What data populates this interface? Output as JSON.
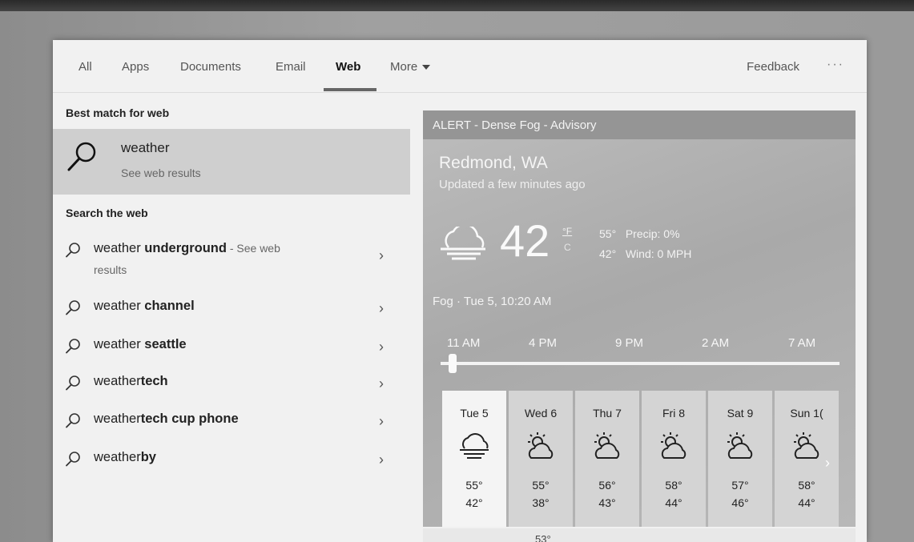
{
  "tabs": [
    {
      "label": "All"
    },
    {
      "label": "Apps"
    },
    {
      "label": "Documents"
    },
    {
      "label": "Email"
    },
    {
      "label": "Web"
    },
    {
      "label": "More"
    }
  ],
  "feedback_label": "Feedback",
  "more_menu_label": "···",
  "left": {
    "best_match_heading": "Best match for web",
    "best_match": {
      "title": "weather",
      "subtitle": "See web results"
    },
    "search_web_heading": "Search the web",
    "suggestions": [
      {
        "prefix": "weather ",
        "bold": "underground",
        "suffix": " - See web",
        "line2": "results"
      },
      {
        "prefix": "weather ",
        "bold": "channel"
      },
      {
        "prefix": "weather ",
        "bold": "seattle"
      },
      {
        "prefix": "weather",
        "bold": "tech"
      },
      {
        "prefix": "weather",
        "bold": "tech cup phone"
      },
      {
        "prefix": "weather",
        "bold": "by"
      }
    ]
  },
  "weather": {
    "alert": "ALERT - Dense Fog - Advisory",
    "location": "Redmond, WA",
    "updated": "Updated a few minutes ago",
    "current_temp": "42",
    "unit_f": "°F",
    "unit_c": "C",
    "high": "55°",
    "low": "42°",
    "precip": "Precip: 0%",
    "wind": "Wind: 0 MPH",
    "condition": "Fog · Tue 5, 10:20 AM",
    "hours": [
      "11 AM",
      "4 PM",
      "9 PM",
      "2 AM",
      "7 AM"
    ],
    "days": [
      {
        "name": "Tue 5",
        "hi": "55°",
        "lo": "42°",
        "icon": "fog-icon"
      },
      {
        "name": "Wed 6",
        "hi": "55°",
        "lo": "38°",
        "icon": "partly-cloudy-icon"
      },
      {
        "name": "Thu 7",
        "hi": "56°",
        "lo": "43°",
        "icon": "partly-cloudy-icon"
      },
      {
        "name": "Fri 8",
        "hi": "58°",
        "lo": "44°",
        "icon": "partly-cloudy-icon"
      },
      {
        "name": "Sat 9",
        "hi": "57°",
        "lo": "46°",
        "icon": "partly-cloudy-icon"
      },
      {
        "name": "Sun 1(",
        "hi": "58°",
        "lo": "44°",
        "icon": "partly-cloudy-icon"
      }
    ],
    "below_temp": "53°"
  }
}
